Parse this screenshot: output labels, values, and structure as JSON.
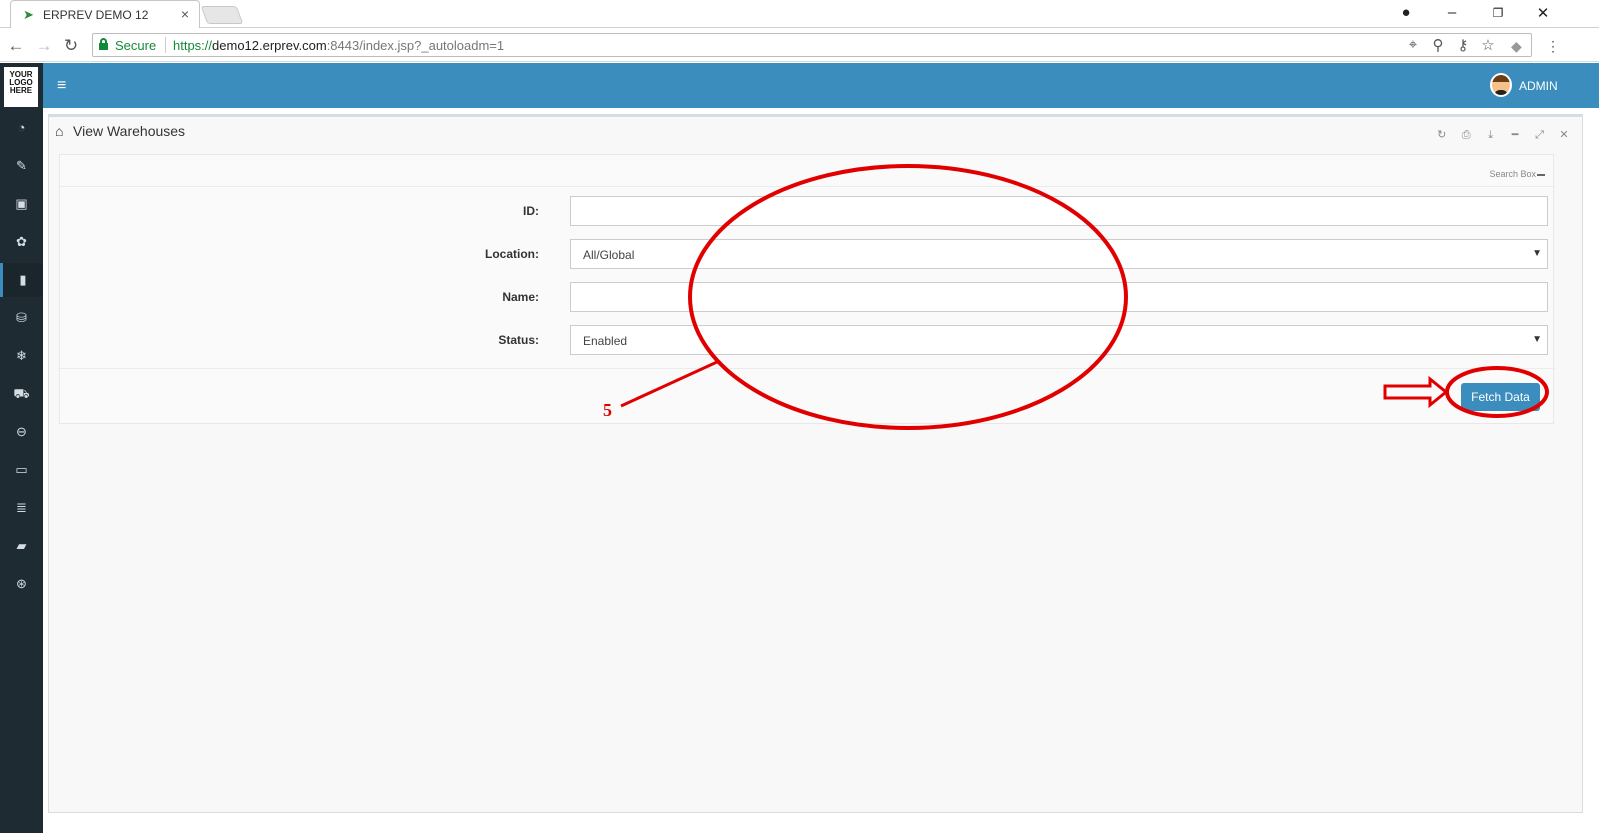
{
  "browser": {
    "tab_title": "ERPREV DEMO 12",
    "tab_close": "×",
    "secure_label": "Secure",
    "url_scheme": "https://",
    "url_host": "demo12.erprev.com",
    "url_rest": ":8443/index.jsp?_autoloadm=1"
  },
  "app": {
    "logo_text": [
      "YOUR",
      "LOGO",
      "HERE"
    ],
    "user_name": "ADMIN",
    "accent_color": "#3b8dbd",
    "sidebar_bg": "#1e2b33",
    "sidebar_icons": [
      "dashboard-icon",
      "tag-icon",
      "money-icon",
      "cubes-icon",
      "document-icon",
      "trash-icon",
      "snowflake-icon",
      "cart-icon",
      "circle-icon",
      "monitor-icon",
      "database-icon",
      "book-icon",
      "lifebuoy-icon"
    ],
    "active_sidebar_index": 4
  },
  "panel": {
    "title": "View Warehouses",
    "tool_icons": [
      "refresh-icon",
      "print-icon",
      "download-icon",
      "minimize-icon",
      "expand-icon",
      "close-icon"
    ]
  },
  "search": {
    "header_label": "Search Box",
    "fields": {
      "id": {
        "label": "ID:",
        "value": ""
      },
      "location": {
        "label": "Location:",
        "value": "All/Global"
      },
      "name": {
        "label": "Name:",
        "value": ""
      },
      "status": {
        "label": "Status:",
        "value": "Enabled"
      }
    },
    "fetch_label": "Fetch Data"
  },
  "annotation": {
    "step_number": "5",
    "color": "#e10000"
  }
}
